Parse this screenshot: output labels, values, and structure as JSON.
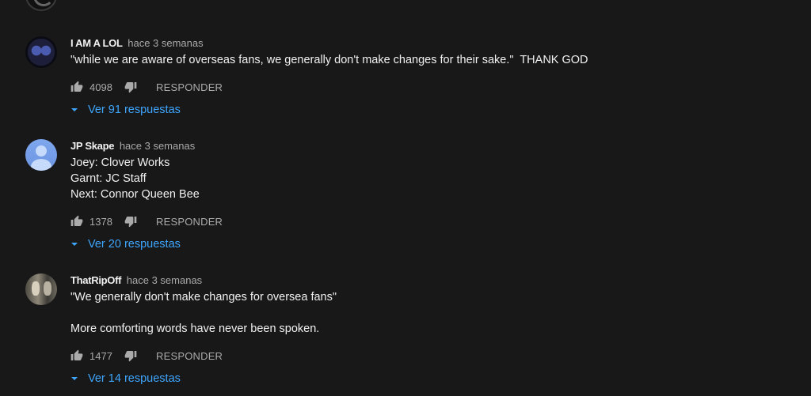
{
  "comments": [
    {
      "author": "I AM A LOL",
      "time": "hace 3 semanas",
      "text": "\"while we are aware of overseas fans, we generally don't make changes for their sake.\"  THANK GOD",
      "likes": "4098",
      "reply_label": "RESPONDER",
      "replies_label": "Ver 91 respuestas"
    },
    {
      "author": "JP Skape",
      "time": "hace 3 semanas",
      "text": "Joey: Clover Works\nGarnt: JC Staff\nNext: Connor Queen Bee",
      "likes": "1378",
      "reply_label": "RESPONDER",
      "replies_label": "Ver 20 respuestas"
    },
    {
      "author": "ThatRipOff",
      "time": "hace 3 semanas",
      "text": "\"We generally don't make changes for oversea fans\"\n\nMore comforting words have never been spoken.",
      "likes": "1477",
      "reply_label": "RESPONDER",
      "replies_label": "Ver 14 respuestas"
    }
  ],
  "icons": {
    "like": "thumb-up-icon",
    "dislike": "thumb-down-icon",
    "expand": "caret-down-icon"
  },
  "colors": {
    "background": "#181818",
    "text": "#f1f1f1",
    "secondary": "#aaaaaa",
    "link": "#3ea6ff"
  }
}
